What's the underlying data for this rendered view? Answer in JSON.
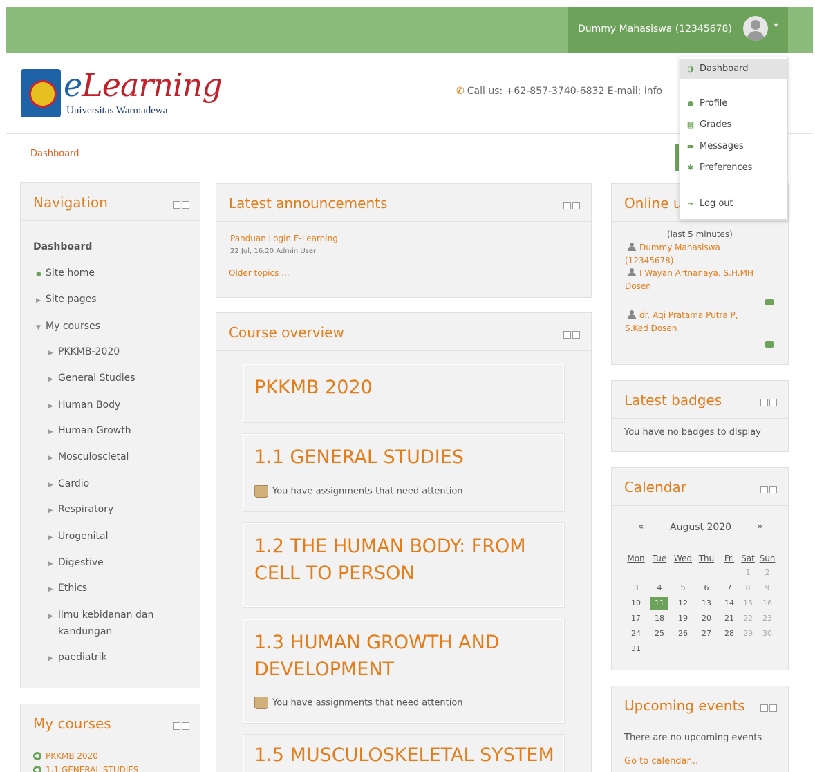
{
  "topbar": {
    "user_name": "Dummy Mahasiswa (12345678)",
    "caret": "▾",
    "accent_color": "#8cbc7b",
    "menu_color": "#6da25a"
  },
  "header": {
    "logo_word_first": "e",
    "logo_word_rest": "Learning",
    "logo_sub": "Universitas Warmadewa",
    "contact": "Call us: +62-857-3740-6832  E-mail: info",
    "phone_icon": "phone-icon",
    "mail_icon": "mail-icon"
  },
  "breadcrumb": "Dashboard",
  "user_dropdown": {
    "items": [
      {
        "label": "Dashboard",
        "icon": "dashboard-icon"
      },
      {
        "label": "Profile",
        "icon": "user-icon"
      },
      {
        "label": "Grades",
        "icon": "grades-icon"
      },
      {
        "label": "Messages",
        "icon": "message-icon"
      },
      {
        "label": "Preferences",
        "icon": "gear-icon"
      },
      {
        "label": "Log out",
        "icon": "logout-icon"
      }
    ]
  },
  "navigation": {
    "title": "Navigation",
    "dashboard": "Dashboard",
    "site_home": "Site home",
    "site_pages": "Site pages",
    "my_courses": "My courses",
    "courses": [
      "PKKMB-2020",
      "General Studies",
      "Human Body",
      "Human Growth",
      "Mosculoscletal",
      "Cardio",
      "Respiratory",
      "Urogenital",
      "Digestive",
      "Ethics",
      "ilmu kebidanan dan",
      "kandungan",
      "paediatrik"
    ]
  },
  "announcements": {
    "title": "Latest announcements",
    "post_title": "Panduan Login E-Learning",
    "post_meta": "22 Jul, 16:20 Admin User",
    "older": "Older topics ..."
  },
  "course_overview": {
    "title": "Course overview",
    "courses": [
      {
        "title": "PKKMB 2020",
        "note": ""
      },
      {
        "title": "1.1 GENERAL STUDIES",
        "note": "You have assignments that need attention"
      },
      {
        "title": "1.2 THE HUMAN BODY: FROM CELL TO PERSON",
        "note": ""
      },
      {
        "title": "1.3 HUMAN GROWTH AND DEVELOPMENT",
        "note": "You have assignments that need attention"
      },
      {
        "title": "1.5 MUSCULOSKELETAL SYSTEM",
        "note": ""
      }
    ]
  },
  "online_users": {
    "title": "Online u",
    "period": "(last 5 minutes)",
    "users": [
      {
        "line1": "Dummy Mahasiswa",
        "line2": "(12345678)"
      },
      {
        "line1": "I Wayan Artnanaya, S.H.MH",
        "line2": "Dosen"
      },
      {
        "line1": "dr. Aqi Pratama Putra P,",
        "line2": "S.Ked Dosen"
      }
    ]
  },
  "badges": {
    "title": "Latest badges",
    "empty": "You have no badges to display"
  },
  "calendar": {
    "title": "Calendar",
    "prev": "«",
    "next": "»",
    "month": "August 2020",
    "weekdays": [
      "Mon",
      "Tue",
      "Wed",
      "Thu",
      "Fri",
      "Sat",
      "Sun"
    ],
    "rows": [
      [
        "",
        "",
        "",
        "",
        "",
        "1",
        "2"
      ],
      [
        "3",
        "4",
        "5",
        "6",
        "7",
        "8",
        "9"
      ],
      [
        "10",
        "11",
        "12",
        "13",
        "14",
        "15",
        "16"
      ],
      [
        "17",
        "18",
        "19",
        "20",
        "21",
        "22",
        "23"
      ],
      [
        "24",
        "25",
        "26",
        "27",
        "28",
        "29",
        "30"
      ],
      [
        "31",
        "",
        "",
        "",
        "",
        "",
        ""
      ]
    ],
    "today": "11"
  },
  "upcoming": {
    "title": "Upcoming events",
    "empty": "There are no upcoming events",
    "goto": "Go to calendar..."
  },
  "my_courses_block": {
    "title": "My courses",
    "items": [
      "PKKMB 2020",
      "1.1 GENERAL STUDIES"
    ]
  }
}
